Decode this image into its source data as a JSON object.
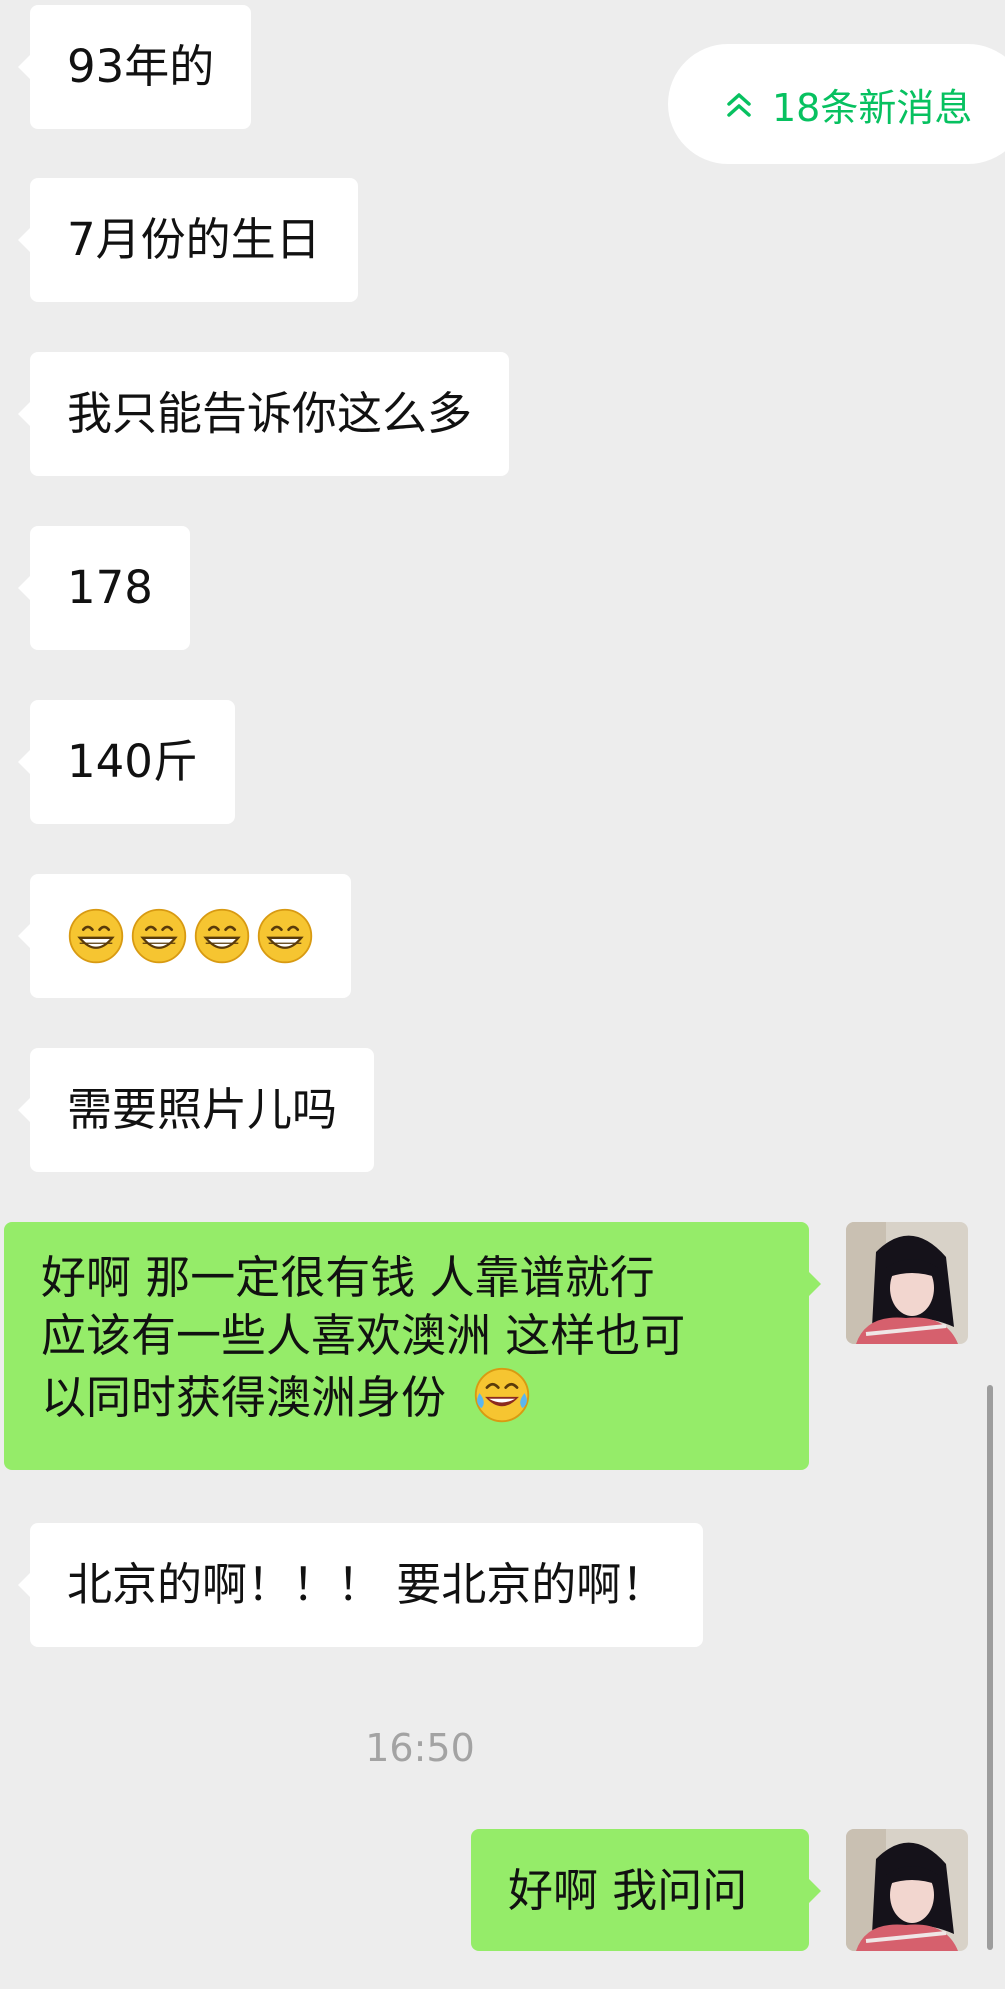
{
  "new_messages": {
    "label": "18条新消息",
    "icon": "double-chevron-up-icon",
    "color": "#07c160"
  },
  "messages": [
    {
      "side": "left",
      "text": "93年的"
    },
    {
      "side": "left",
      "text": "7月份的生日"
    },
    {
      "side": "left",
      "text": "我只能告诉你这么多"
    },
    {
      "side": "left",
      "text": "178"
    },
    {
      "side": "left",
      "text": "140斤"
    },
    {
      "side": "left",
      "emoji": [
        "grinning-face-icon",
        "grinning-face-icon",
        "grinning-face-icon",
        "grinning-face-icon"
      ]
    },
    {
      "side": "left",
      "text": "需要照片儿吗"
    },
    {
      "side": "right",
      "lines": [
        "好啊 那一定很有钱 人靠谱就行",
        "应该有一些人喜欢澳洲  这样也可",
        "以同时获得澳洲身份"
      ],
      "trailing_emoji": "tears-of-joy-icon"
    },
    {
      "side": "left",
      "text": "北京的啊！！！ 要北京的啊！"
    },
    {
      "side": "right",
      "text": "好啊 我问问"
    }
  ],
  "timestamp": "16:50",
  "colors": {
    "background": "#ededed",
    "incoming_bubble": "#ffffff",
    "outgoing_bubble": "#95ec69",
    "accent": "#07c160"
  }
}
